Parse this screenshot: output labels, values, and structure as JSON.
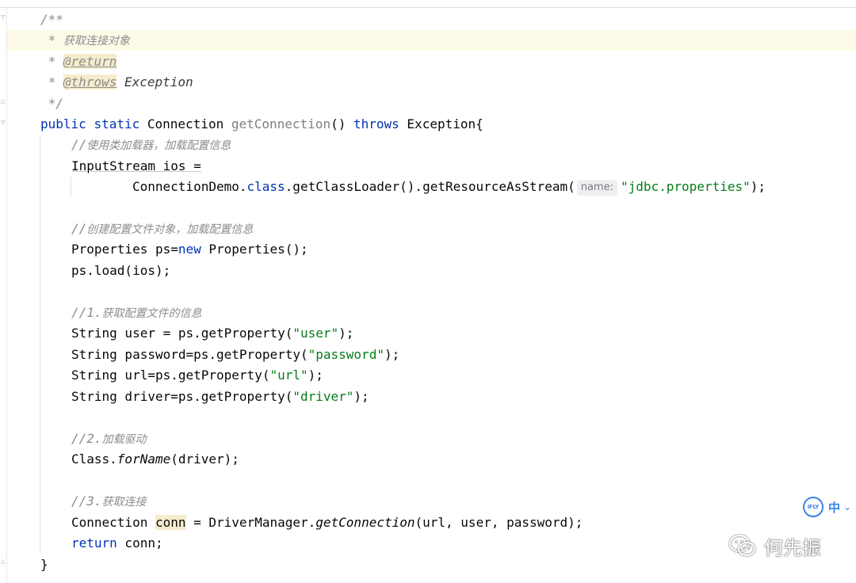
{
  "editor": {
    "lines": {
      "l1": "/**",
      "l2_star": " * ",
      "l2_text": "获取连接对象",
      "l3_star": " * ",
      "l3_tag": "@return",
      "l4_star": " * ",
      "l4_tag": "@throws",
      "l4_ref": " Exception",
      "l5": " */",
      "sig_public": "public",
      "sig_static": "static",
      "sig_type": "Connection",
      "sig_name": "getConnection",
      "sig_parens": "()",
      "sig_throws": "throws",
      "sig_exc": "Exception{",
      "c1_slash": "//",
      "c1_text": "使用类加载器，加载配置信息",
      "ins_decl": "InputStream ios =",
      "cont_a": "ConnectionDemo.",
      "cont_class": "class",
      "cont_b": ".getClassLoader().getResourceAsStream(",
      "cont_hint": "name:",
      "cont_str": "\"jdbc.properties\"",
      "cont_end": ");",
      "c2_slash": "//",
      "c2_text": "创建配置文件对象，加载配置信息",
      "props_a": "Properties ps=",
      "props_new": "new",
      "props_b": " Properties();",
      "load": "ps.load(ios);",
      "c3_slash": "//1.",
      "c3_text": "获取配置文件的信息",
      "user_a": "String user = ps.getProperty(",
      "user_str": "\"user\"",
      "user_end": ");",
      "pw_a": "String password=ps.getProperty(",
      "pw_str": "\"password\"",
      "pw_end": ");",
      "url_a": "String url=ps.getProperty(",
      "url_str": "\"url\"",
      "url_end": ");",
      "drv_a": "String driver=ps.getProperty(",
      "drv_str": "\"driver\"",
      "drv_end": ");",
      "c4_slash": "//2.",
      "c4_text": "加载驱动",
      "forname_a": "Class.",
      "forname_m": "forName",
      "forname_b": "(driver);",
      "c5_slash": "//3.",
      "c5_text": "获取连接",
      "conn_type": "Connection ",
      "conn_var": "conn",
      "conn_a": " = DriverManager.",
      "conn_m": "getConnection",
      "conn_b": "(url, user, password);",
      "ret_kw": "return",
      "ret_b": " conn;",
      "close": "}"
    }
  },
  "ime": {
    "logo": "iFLY",
    "mode": "中",
    "arrow": "⌄"
  },
  "watermark": {
    "icon": "wechat-icon",
    "text": "何先振"
  },
  "colors": {
    "keyword": "#0033b3",
    "string": "#067d17",
    "comment": "#8c8c8c",
    "tag_bg": "#f5eccd",
    "current_line": "#fdfbe8",
    "ime_blue": "#3b82e8"
  }
}
